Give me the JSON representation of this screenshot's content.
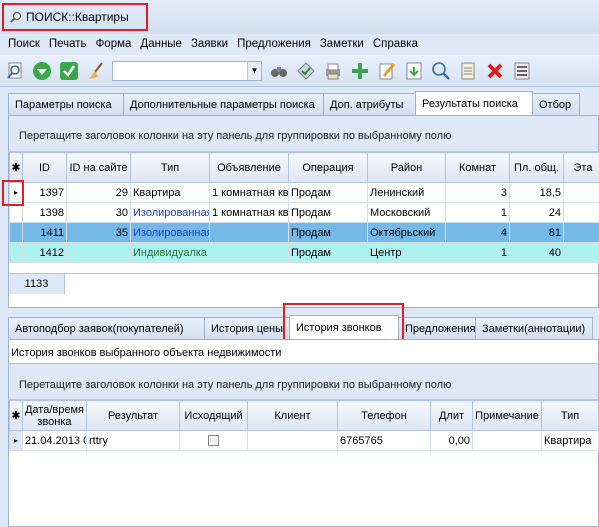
{
  "window": {
    "title": "ПОИСК::Квартиры",
    "icon": "search-magnifier-icon"
  },
  "menu": [
    "Поиск",
    "Печать",
    "Форма",
    "Данные",
    "Заявки",
    "Предложения",
    "Заметки",
    "Справка"
  ],
  "toolbar": {
    "icons": [
      "search-icon",
      "down-arrow-circle-icon",
      "phone-check-icon",
      "broom-icon"
    ],
    "icons2": [
      "binoculars-icon",
      "check-tag-icon",
      "printer-icon",
      "add-icon",
      "edit-icon",
      "save-icon",
      "magnifier-icon",
      "document-icon",
      "delete-icon",
      "list-icon"
    ],
    "combo_value": ""
  },
  "top_tabs": [
    "Параметры поиска",
    "Дополнительные параметры поиска",
    "Доп. атрибуты",
    "Результаты поиска",
    "Отбор"
  ],
  "top_tabs_active": 3,
  "results": {
    "group_hint": "Перетащите заголовок колонки на эту панель для группировки по выбранному полю",
    "columns": [
      "✱",
      "ID",
      "ID на сайте",
      "Тип",
      "Объявление",
      "Операция",
      "Район",
      "Комнат",
      "Пл. общ.",
      "Эта"
    ],
    "rows": [
      [
        "▸",
        "1397",
        "29",
        "Квартира",
        "1 комнатная кв",
        "Продам",
        "Ленинский",
        "3",
        "18,5",
        ""
      ],
      [
        "",
        "1398",
        "30",
        "Изолированная",
        "1 комнатная кв",
        "Продам",
        "Московский",
        "1",
        "24",
        ""
      ],
      [
        "",
        "1411",
        "35",
        "Изолированная",
        "",
        "Продам",
        "Октябрьский",
        "4",
        "81",
        ""
      ],
      [
        "",
        "1412",
        "",
        "Индивидуалка",
        "",
        "Продам",
        "Центр",
        "1",
        "40",
        ""
      ]
    ],
    "total": "1133"
  },
  "bottom_tabs": [
    "Автоподбор заявок(покупателей)",
    "История цены",
    "История звонков",
    "Предложения",
    "Заметки(аннотации)"
  ],
  "bottom_tabs_active": 2,
  "calls": {
    "title": "История звонков выбранного объекта недвижимости",
    "group_hint": "Перетащите заголовок колонки на эту панель для группировки по выбранному полю",
    "columns": [
      "✱",
      "Дата/время звонка",
      "Результат",
      "Исходящий",
      "Клиент",
      "Телефон",
      "Длит",
      "Примечание",
      "Тип"
    ],
    "rows": [
      [
        "▸",
        "21.04.2013 0",
        "rttry",
        "",
        "",
        "6765765",
        "0,00",
        "",
        "Квартира"
      ]
    ]
  }
}
